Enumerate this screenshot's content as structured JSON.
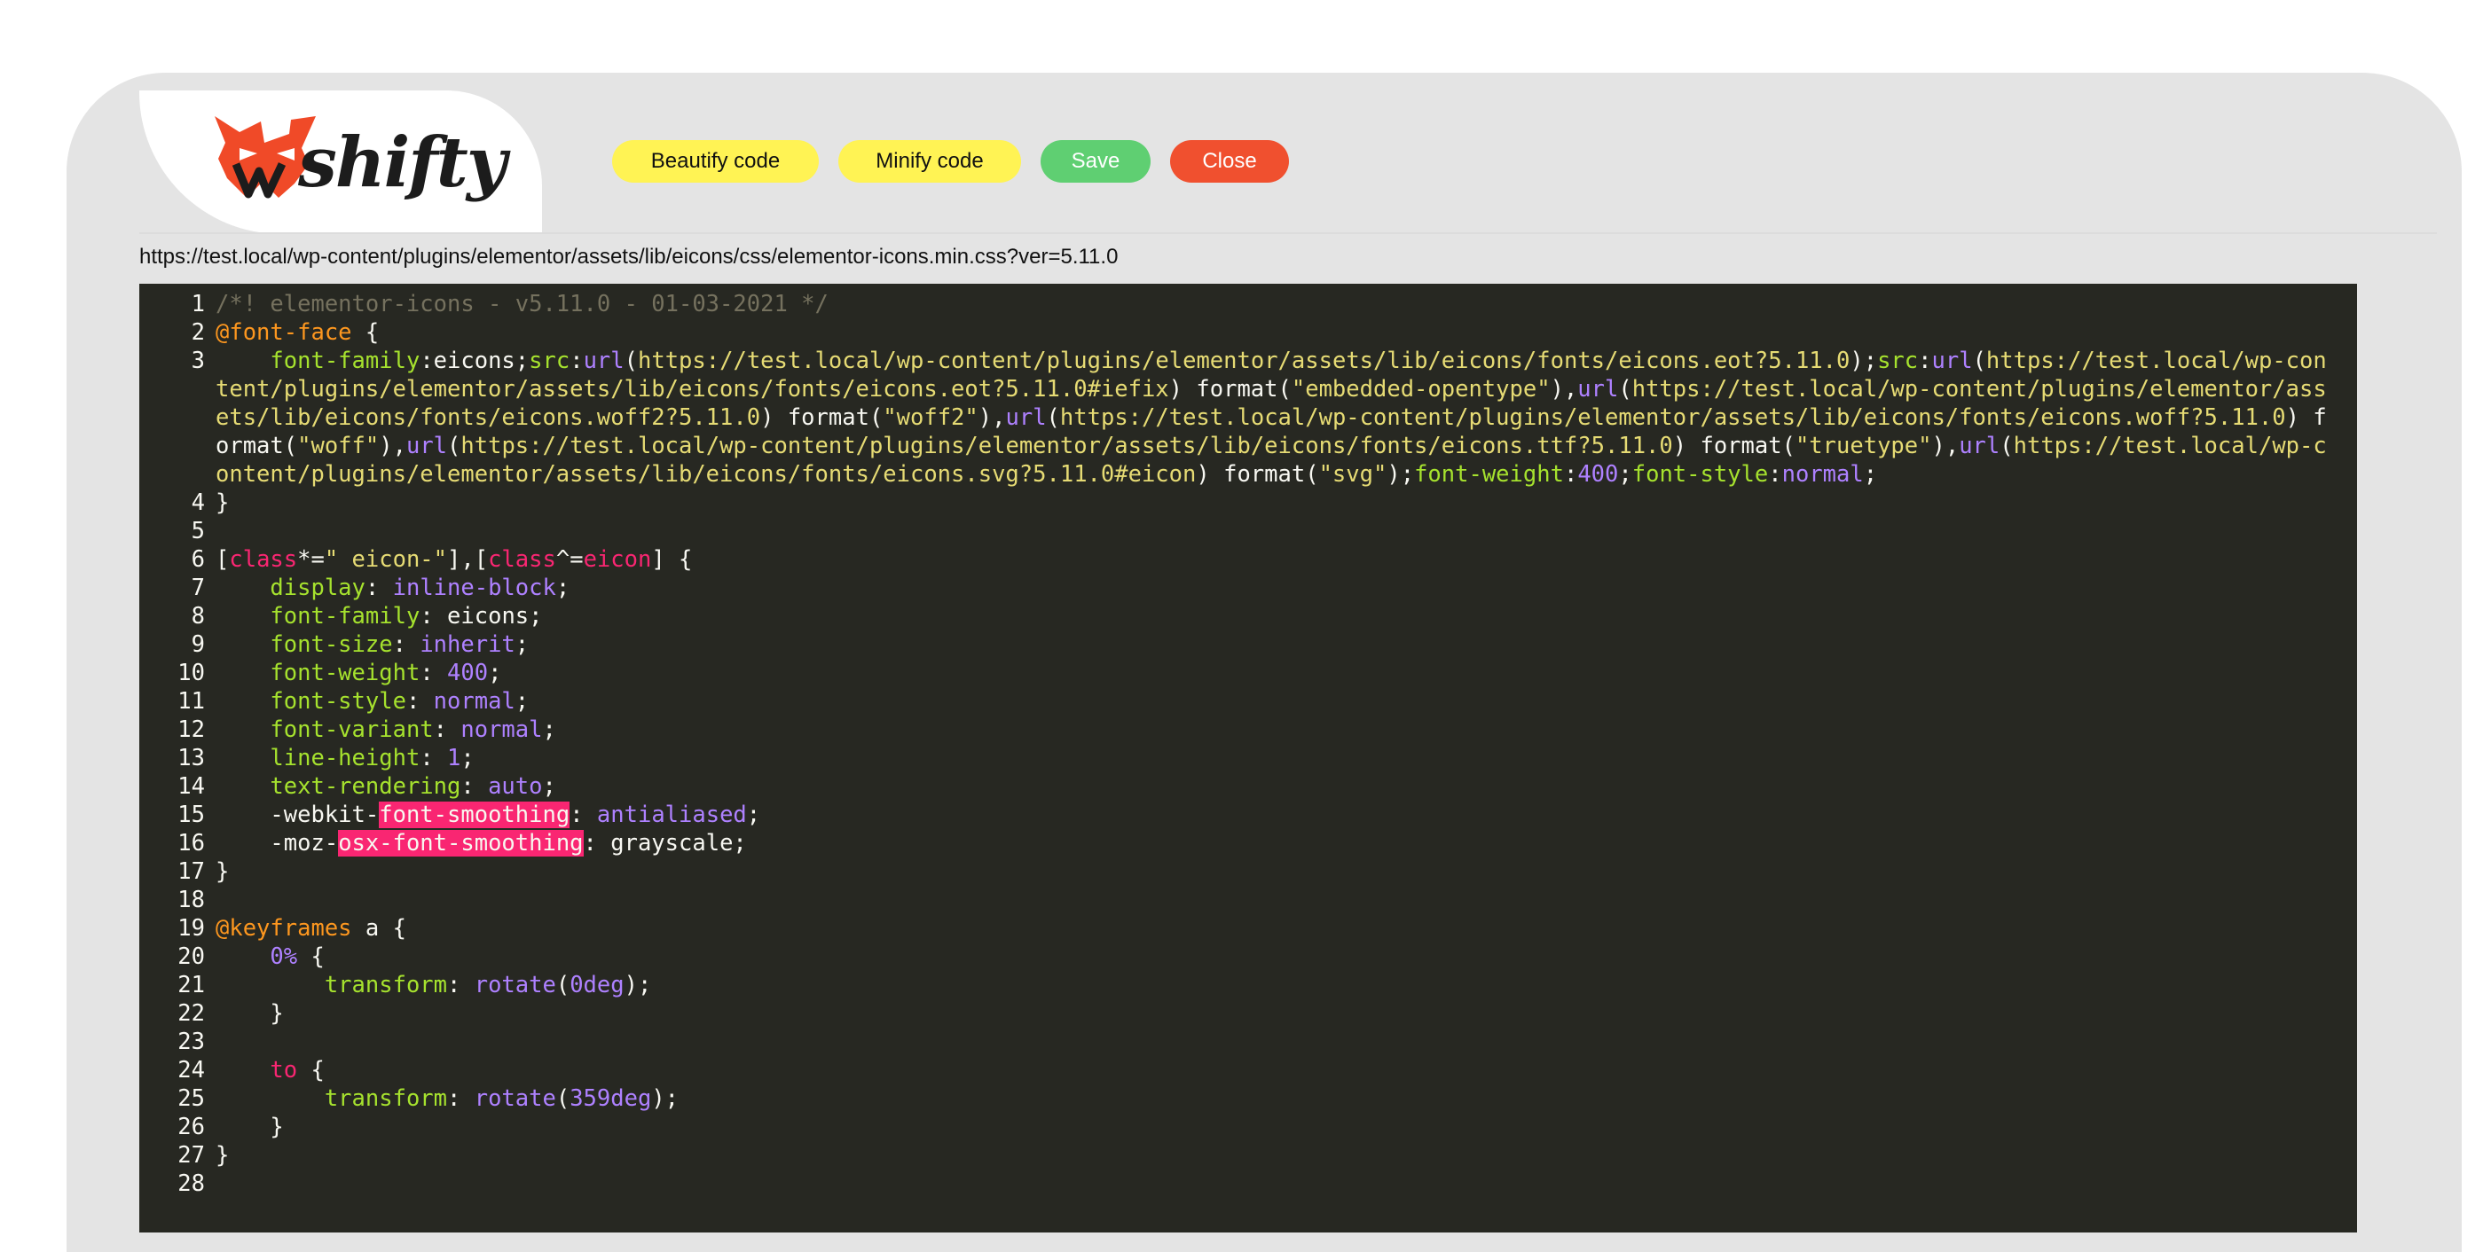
{
  "app": {
    "logo_text": "WPshifty",
    "logo_text_visible": "shifty",
    "brand_colors": {
      "fox": "#f04a28",
      "text": "#1c1c1c"
    }
  },
  "toolbar": {
    "beautify_label": "Beautify code",
    "minify_label": "Minify code",
    "save_label": "Save",
    "close_label": "Close"
  },
  "file": {
    "url": "https://test.local/wp-content/plugins/elementor/assets/lib/eicons/css/elementor-icons.min.css?ver=5.11.0"
  },
  "editor": {
    "theme": "monokai",
    "lines": [
      {
        "n": "1",
        "tokens": [
          [
            "comment",
            "/*! elementor-icons - v5.11.0 - 01-03-2021 */"
          ]
        ]
      },
      {
        "n": "2",
        "tokens": [
          [
            "at",
            "@font-face"
          ],
          [
            "pun",
            " {"
          ]
        ]
      },
      {
        "n": "3",
        "tokens": [
          [
            "plain",
            "    "
          ],
          [
            "prop",
            "font-family"
          ],
          [
            "pun",
            ":"
          ],
          [
            "plain",
            "eicons"
          ],
          [
            "pun",
            ";"
          ],
          [
            "prop",
            "src"
          ],
          [
            "pun",
            ":"
          ],
          [
            "val",
            "url"
          ],
          [
            "pun",
            "("
          ],
          [
            "str",
            "https://test.local/wp-content/plugins/elementor/assets/lib/eicons/fonts/eicons.eot?5.11.0"
          ],
          [
            "pun",
            ");"
          ],
          [
            "prop",
            "src"
          ],
          [
            "pun",
            ":"
          ],
          [
            "val",
            "url"
          ],
          [
            "pun",
            "("
          ],
          [
            "str",
            "https://test.local/wp-content/plugins/elementor/assets/lib/eicons/fonts/eicons.eot?5.11.0#iefix"
          ],
          [
            "pun",
            ") "
          ],
          [
            "plain",
            "format"
          ],
          [
            "pun",
            "("
          ],
          [
            "str",
            "\"embedded-opentype\""
          ],
          [
            "pun",
            "),"
          ],
          [
            "val",
            "url"
          ],
          [
            "pun",
            "("
          ],
          [
            "str",
            "https://test.local/wp-content/plugins/elementor/assets/lib/eicons/fonts/eicons.woff2?5.11.0"
          ],
          [
            "pun",
            ") "
          ],
          [
            "plain",
            "format"
          ],
          [
            "pun",
            "("
          ],
          [
            "str",
            "\"woff2\""
          ],
          [
            "pun",
            "),"
          ],
          [
            "val",
            "url"
          ],
          [
            "pun",
            "("
          ],
          [
            "str",
            "https://test.local/wp-content/plugins/elementor/assets/lib/eicons/fonts/eicons.woff?5.11.0"
          ],
          [
            "pun",
            ") "
          ],
          [
            "plain",
            "format"
          ],
          [
            "pun",
            "("
          ],
          [
            "str",
            "\"woff\""
          ],
          [
            "pun",
            "),"
          ],
          [
            "val",
            "url"
          ],
          [
            "pun",
            "("
          ],
          [
            "str",
            "https://test.local/wp-content/plugins/elementor/assets/lib/eicons/fonts/eicons.ttf?5.11.0"
          ],
          [
            "pun",
            ") "
          ],
          [
            "plain",
            "format"
          ],
          [
            "pun",
            "("
          ],
          [
            "str",
            "\"truetype\""
          ],
          [
            "pun",
            "),"
          ],
          [
            "val",
            "url"
          ],
          [
            "pun",
            "("
          ],
          [
            "str",
            "https://test.local/wp-content/plugins/elementor/assets/lib/eicons/fonts/eicons.svg?5.11.0#eicon"
          ],
          [
            "pun",
            ") "
          ],
          [
            "plain",
            "format"
          ],
          [
            "pun",
            "("
          ],
          [
            "str",
            "\"svg\""
          ],
          [
            "pun",
            ");"
          ],
          [
            "prop",
            "font-weight"
          ],
          [
            "pun",
            ":"
          ],
          [
            "val",
            "400"
          ],
          [
            "pun",
            ";"
          ],
          [
            "prop",
            "font-style"
          ],
          [
            "pun",
            ":"
          ],
          [
            "val",
            "normal"
          ],
          [
            "pun",
            ";"
          ]
        ]
      },
      {
        "n": "4",
        "tokens": [
          [
            "pun",
            "}"
          ]
        ]
      },
      {
        "n": "5",
        "tokens": []
      },
      {
        "n": "6",
        "tokens": [
          [
            "pun",
            "["
          ],
          [
            "attr",
            "class"
          ],
          [
            "pun",
            "*="
          ],
          [
            "str",
            "\" eicon-\""
          ],
          [
            "pun",
            "],["
          ],
          [
            "attr",
            "class"
          ],
          [
            "pun",
            "^="
          ],
          [
            "attr",
            "eicon"
          ],
          [
            "pun",
            "] {"
          ]
        ]
      },
      {
        "n": "7",
        "tokens": [
          [
            "plain",
            "    "
          ],
          [
            "prop",
            "display"
          ],
          [
            "pun",
            ": "
          ],
          [
            "val",
            "inline-block"
          ],
          [
            "pun",
            ";"
          ]
        ]
      },
      {
        "n": "8",
        "tokens": [
          [
            "plain",
            "    "
          ],
          [
            "prop",
            "font-family"
          ],
          [
            "pun",
            ": "
          ],
          [
            "plain",
            "eicons"
          ],
          [
            "pun",
            ";"
          ]
        ]
      },
      {
        "n": "9",
        "tokens": [
          [
            "plain",
            "    "
          ],
          [
            "prop",
            "font-size"
          ],
          [
            "pun",
            ": "
          ],
          [
            "val",
            "inherit"
          ],
          [
            "pun",
            ";"
          ]
        ]
      },
      {
        "n": "10",
        "tokens": [
          [
            "plain",
            "    "
          ],
          [
            "prop",
            "font-weight"
          ],
          [
            "pun",
            ": "
          ],
          [
            "val",
            "400"
          ],
          [
            "pun",
            ";"
          ]
        ]
      },
      {
        "n": "11",
        "tokens": [
          [
            "plain",
            "    "
          ],
          [
            "prop",
            "font-style"
          ],
          [
            "pun",
            ": "
          ],
          [
            "val",
            "normal"
          ],
          [
            "pun",
            ";"
          ]
        ]
      },
      {
        "n": "12",
        "tokens": [
          [
            "plain",
            "    "
          ],
          [
            "prop",
            "font-variant"
          ],
          [
            "pun",
            ": "
          ],
          [
            "val",
            "normal"
          ],
          [
            "pun",
            ";"
          ]
        ]
      },
      {
        "n": "13",
        "tokens": [
          [
            "plain",
            "    "
          ],
          [
            "prop",
            "line-height"
          ],
          [
            "pun",
            ": "
          ],
          [
            "val",
            "1"
          ],
          [
            "pun",
            ";"
          ]
        ]
      },
      {
        "n": "14",
        "tokens": [
          [
            "plain",
            "    "
          ],
          [
            "prop",
            "text-rendering"
          ],
          [
            "pun",
            ": "
          ],
          [
            "val",
            "auto"
          ],
          [
            "pun",
            ";"
          ]
        ]
      },
      {
        "n": "15",
        "tokens": [
          [
            "plain",
            "    -webkit-"
          ],
          [
            "err",
            "font-smoothing"
          ],
          [
            "pun",
            ": "
          ],
          [
            "val",
            "antialiased"
          ],
          [
            "pun",
            ";"
          ]
        ]
      },
      {
        "n": "16",
        "tokens": [
          [
            "plain",
            "    -moz-"
          ],
          [
            "err",
            "osx-font-smoothing"
          ],
          [
            "pun",
            ": "
          ],
          [
            "plain",
            "grayscale"
          ],
          [
            "pun",
            ";"
          ]
        ]
      },
      {
        "n": "17",
        "tokens": [
          [
            "pun",
            "}"
          ]
        ]
      },
      {
        "n": "18",
        "tokens": []
      },
      {
        "n": "19",
        "tokens": [
          [
            "at",
            "@keyframes"
          ],
          [
            "plain",
            " a "
          ],
          [
            "pun",
            "{"
          ]
        ]
      },
      {
        "n": "20",
        "tokens": [
          [
            "plain",
            "    "
          ],
          [
            "val",
            "0%"
          ],
          [
            "pun",
            " {"
          ]
        ]
      },
      {
        "n": "21",
        "tokens": [
          [
            "plain",
            "        "
          ],
          [
            "prop",
            "transform"
          ],
          [
            "pun",
            ": "
          ],
          [
            "val",
            "rotate"
          ],
          [
            "pun",
            "("
          ],
          [
            "val",
            "0deg"
          ],
          [
            "pun",
            ");"
          ]
        ]
      },
      {
        "n": "22",
        "tokens": [
          [
            "plain",
            "    "
          ],
          [
            "pun",
            "}"
          ]
        ]
      },
      {
        "n": "23",
        "tokens": []
      },
      {
        "n": "24",
        "tokens": [
          [
            "plain",
            "    "
          ],
          [
            "attr",
            "to"
          ],
          [
            "pun",
            " {"
          ]
        ]
      },
      {
        "n": "25",
        "tokens": [
          [
            "plain",
            "        "
          ],
          [
            "prop",
            "transform"
          ],
          [
            "pun",
            ": "
          ],
          [
            "val",
            "rotate"
          ],
          [
            "pun",
            "("
          ],
          [
            "val",
            "359deg"
          ],
          [
            "pun",
            ");"
          ]
        ]
      },
      {
        "n": "26",
        "tokens": [
          [
            "plain",
            "    "
          ],
          [
            "pun",
            "}"
          ]
        ]
      },
      {
        "n": "27",
        "tokens": [
          [
            "pun",
            "}"
          ]
        ]
      },
      {
        "n": "28",
        "tokens": []
      }
    ]
  }
}
